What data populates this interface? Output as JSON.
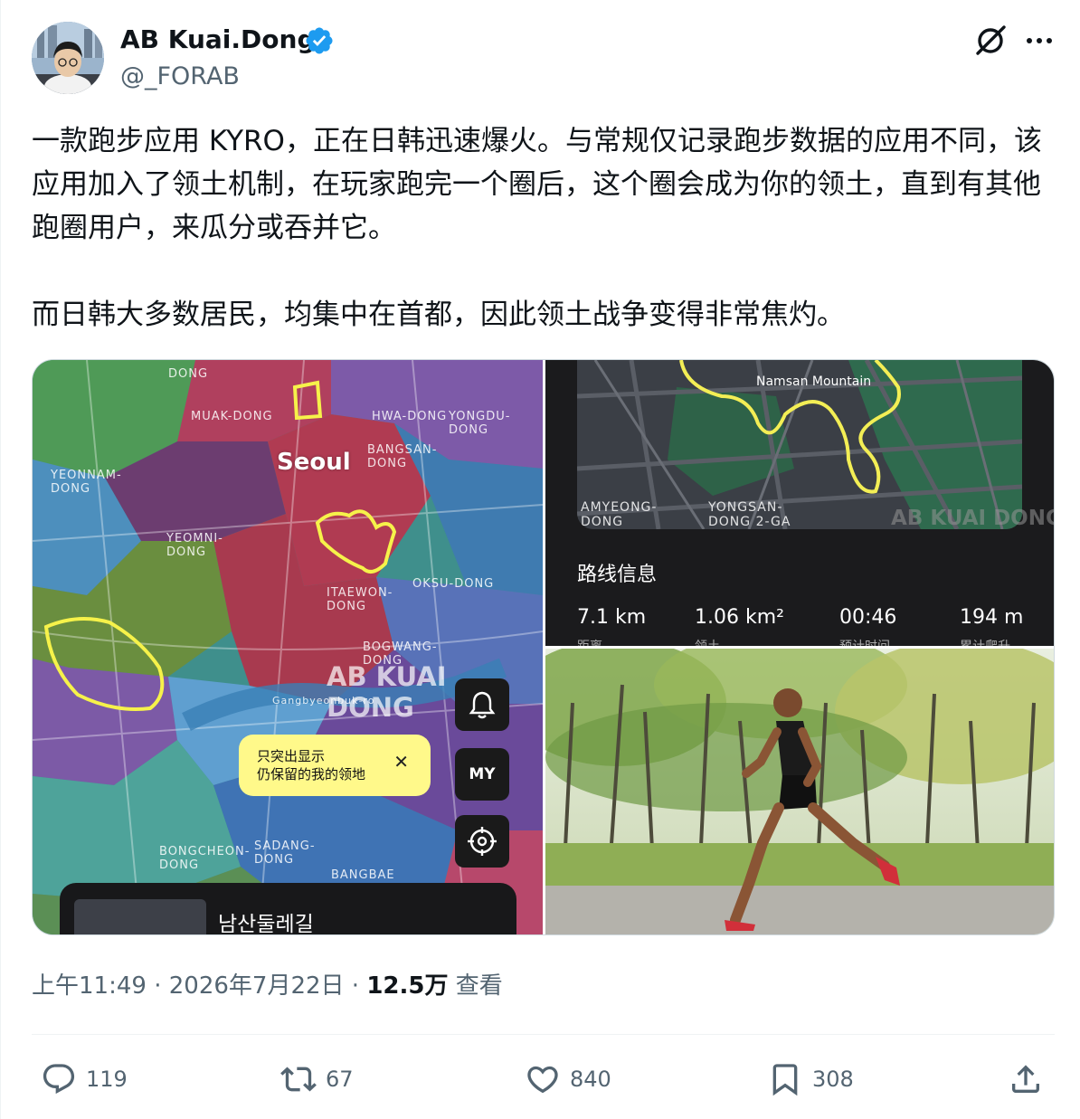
{
  "author": {
    "display_name": "AB Kuai.Dong",
    "handle": "@_FORAB",
    "verified": true,
    "brand_color": "#1d9bf0"
  },
  "header_icons": [
    "grok-icon",
    "more-icon"
  ],
  "tweet": {
    "paragraphs": [
      "一款跑步应用 KYRO，正在日韩迅速爆火。与常规仅记录跑步数据的应用不同，该应用加入了领土机制，在玩家跑完一个圈后，这个圈会成为你的领土，直到有其他跑圈用户，来瓜分或吞并它。",
      "而日韩大多数居民，均集中在首都，因此领土战争变得非常焦灼。"
    ]
  },
  "media": {
    "map_screenshot": {
      "city_label": "Seoul",
      "district_labels": [
        "DONG",
        "MUAK-DONG",
        "HWA-DONG",
        "YONGDU-DONG",
        "BANGSAN-DONG",
        "YEONNAM-DONG",
        "YEOMNI-DONG",
        "ITAEWON-DONG",
        "OKSU-DONG",
        "BOGWANG-DONG",
        "BONGCHEON-DONG",
        "SADANG-DONG",
        "BANGBAE",
        "Gangbyeonbuk-ro"
      ],
      "watermark": "AB KUAI DONG",
      "tooltip_line1": "只突出显示",
      "tooltip_line2": "仍保留的我的领地",
      "tooltip_close": "✕",
      "my_button": "MY",
      "route_name": "남산둘레길"
    },
    "route_info": {
      "landmark": "Namsan Mountain",
      "area_labels": [
        "AMYEONG-DONG",
        "YONGSAN-DONG 2-GA"
      ],
      "watermark": "AB KUAI DONG",
      "title": "路线信息",
      "stats": [
        {
          "value": "7.1 km",
          "label": "距离"
        },
        {
          "value": "1.06 km²",
          "label": "领土"
        },
        {
          "value": "00:46",
          "label": "预计时间"
        },
        {
          "value": "194 m",
          "label": "累计爬升"
        }
      ]
    },
    "runner_photo": "runner-photo"
  },
  "meta": {
    "time": "上午11:49",
    "separator": "·",
    "date": "2026年7月22日",
    "views": "12.5万",
    "views_label": "查看"
  },
  "actions": {
    "reply": "119",
    "retweet": "67",
    "like": "840",
    "bookmark": "308"
  }
}
